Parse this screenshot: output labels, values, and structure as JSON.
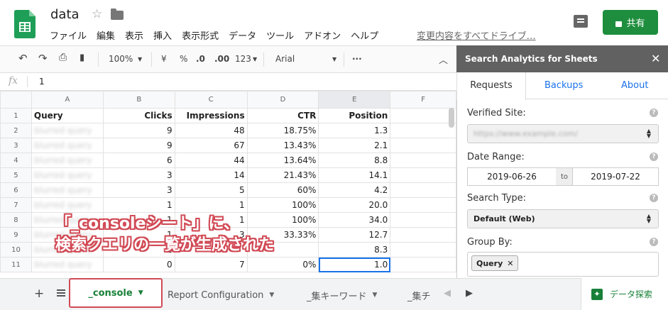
{
  "app": {
    "doc_title": "data",
    "menu": [
      "ファイル",
      "編集",
      "表示",
      "挿入",
      "表示形式",
      "データ",
      "ツール",
      "アドオン",
      "ヘルプ"
    ],
    "last_edit": "変更内容をすべてドライブ…",
    "share_label": "共有"
  },
  "toolbar": {
    "zoom": "100%",
    "currency": "¥",
    "percent": "%",
    "dec_decrease": ".0",
    "dec_increase": ".00",
    "more_formats": "123",
    "font": "Arial",
    "more": "..."
  },
  "formula_bar": {
    "fx": "fx",
    "value": "1"
  },
  "grid": {
    "columns": [
      "A",
      "B",
      "C",
      "D",
      "E",
      "F"
    ],
    "header_row": {
      "row": "1",
      "a": "Query",
      "b": "Clicks",
      "c": "Impressions",
      "d": "CTR",
      "e": "Position"
    },
    "rows": [
      {
        "row": "2",
        "a": "blurred query",
        "b": "9",
        "c": "48",
        "d": "18.75%",
        "e": "1.3"
      },
      {
        "row": "3",
        "a": "blurred query",
        "b": "9",
        "c": "67",
        "d": "13.43%",
        "e": "2.1"
      },
      {
        "row": "4",
        "a": "blurred query",
        "b": "6",
        "c": "44",
        "d": "13.64%",
        "e": "8.8"
      },
      {
        "row": "5",
        "a": "blurred query",
        "b": "3",
        "c": "14",
        "d": "21.43%",
        "e": "14.1"
      },
      {
        "row": "6",
        "a": "blurred query",
        "b": "3",
        "c": "5",
        "d": "60%",
        "e": "4.2"
      },
      {
        "row": "7",
        "a": "blurred query",
        "b": "1",
        "c": "1",
        "d": "100%",
        "e": "20.0"
      },
      {
        "row": "8",
        "a": "blurred query",
        "b": "1",
        "c": "1",
        "d": "100%",
        "e": "34.0"
      },
      {
        "row": "9",
        "a": "blurred query",
        "b": "1",
        "c": "3",
        "d": "33.33%",
        "e": "12.7"
      },
      {
        "row": "10",
        "a": "blurred query",
        "b": "1",
        "c": "",
        "d": "",
        "e": "8.3"
      },
      {
        "row": "11",
        "a": "blurred query",
        "b": "0",
        "c": "7",
        "d": "0%",
        "e": "1.0"
      }
    ]
  },
  "annotation": {
    "line1": "「_consoleシート」に、",
    "line2": "検索クエリの一覧が生成された"
  },
  "sheets": {
    "add": "+",
    "tabs": [
      "_console",
      "Report Configuration",
      "_集キーワード",
      "_集チ"
    ],
    "explore": "データ探索"
  },
  "sidebar": {
    "title": "Search Analytics for Sheets",
    "tabs": [
      "Requests",
      "Backups",
      "About"
    ],
    "verified_site_label": "Verified Site:",
    "verified_site_value": "https://www.example.com/",
    "date_range_label": "Date Range:",
    "date_from": "2019-06-26",
    "date_to_word": "to",
    "date_to": "2019-07-22",
    "search_type_label": "Search Type:",
    "search_type_value": "Default (Web)",
    "group_by_label": "Group By:",
    "group_by_chip": "Query"
  }
}
